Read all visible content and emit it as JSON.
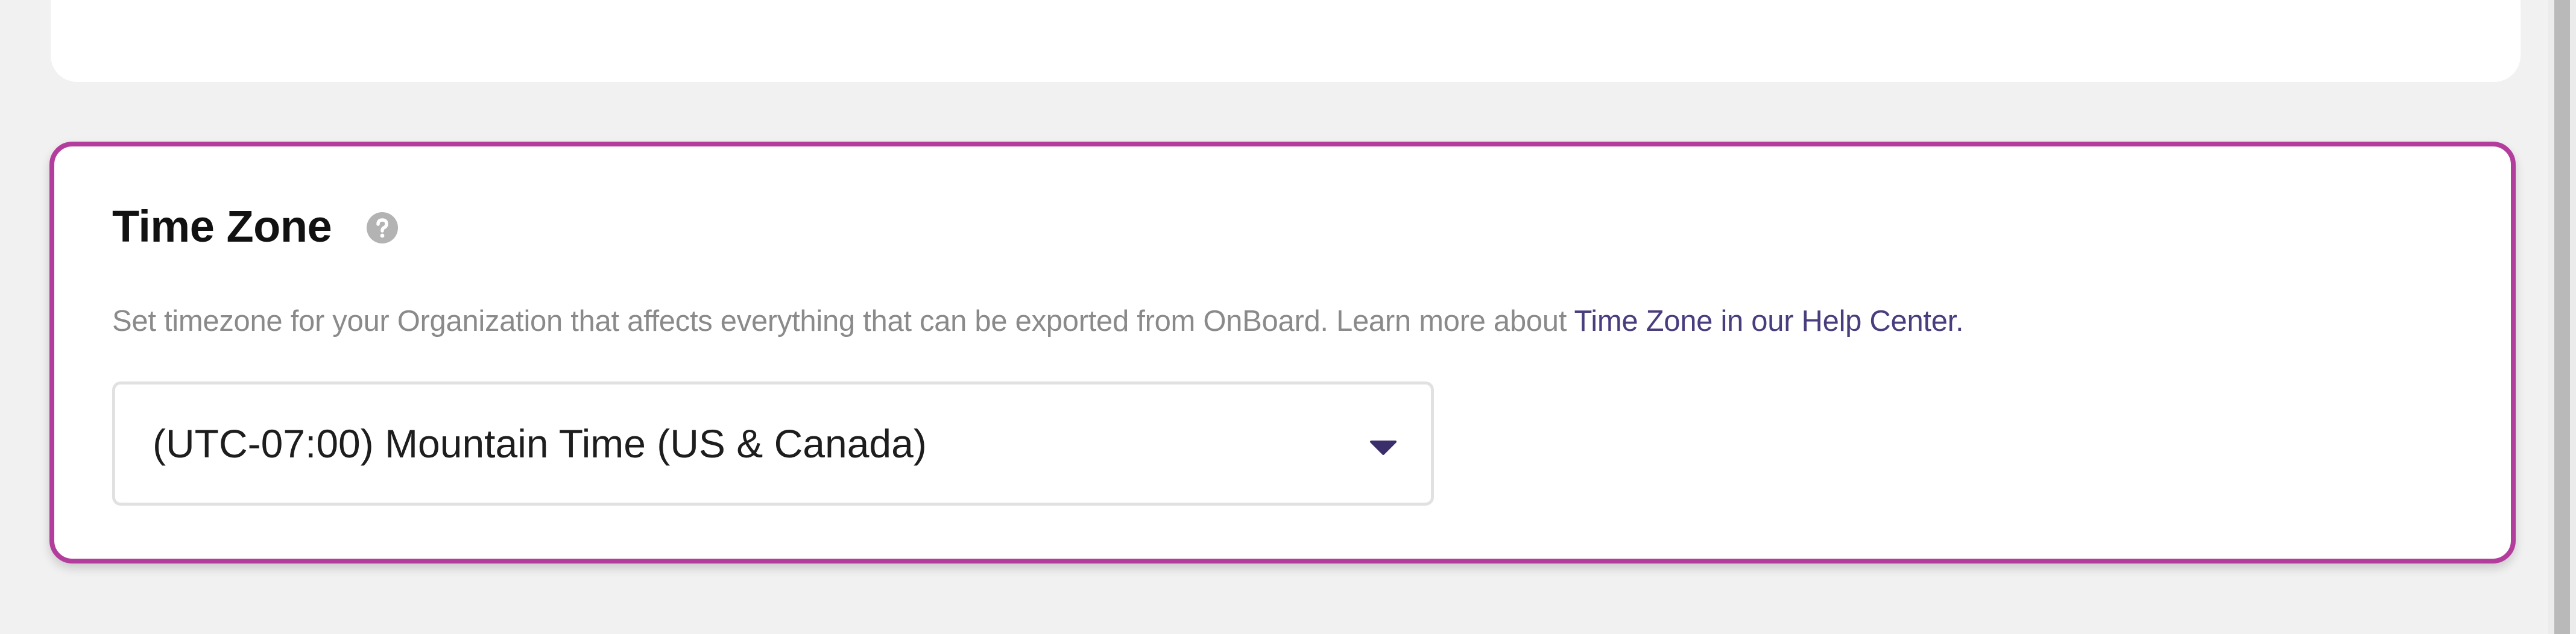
{
  "time_zone_card": {
    "title": "Time Zone",
    "help_icon": "question-circle-icon",
    "description": "Set timezone for your Organization that affects everything that can be exported from OnBoard. Learn more about ",
    "help_link": "Time Zone in our Help Center.",
    "select": {
      "selected_value": "(UTC-07:00) Mountain Time (US & Canada)",
      "caret_icon": "caret-down-icon"
    }
  },
  "colors": {
    "highlight_border": "#b23d9c",
    "link": "#4a3d7e",
    "caret": "#3b2f6b",
    "background": "#f1f1f1"
  }
}
